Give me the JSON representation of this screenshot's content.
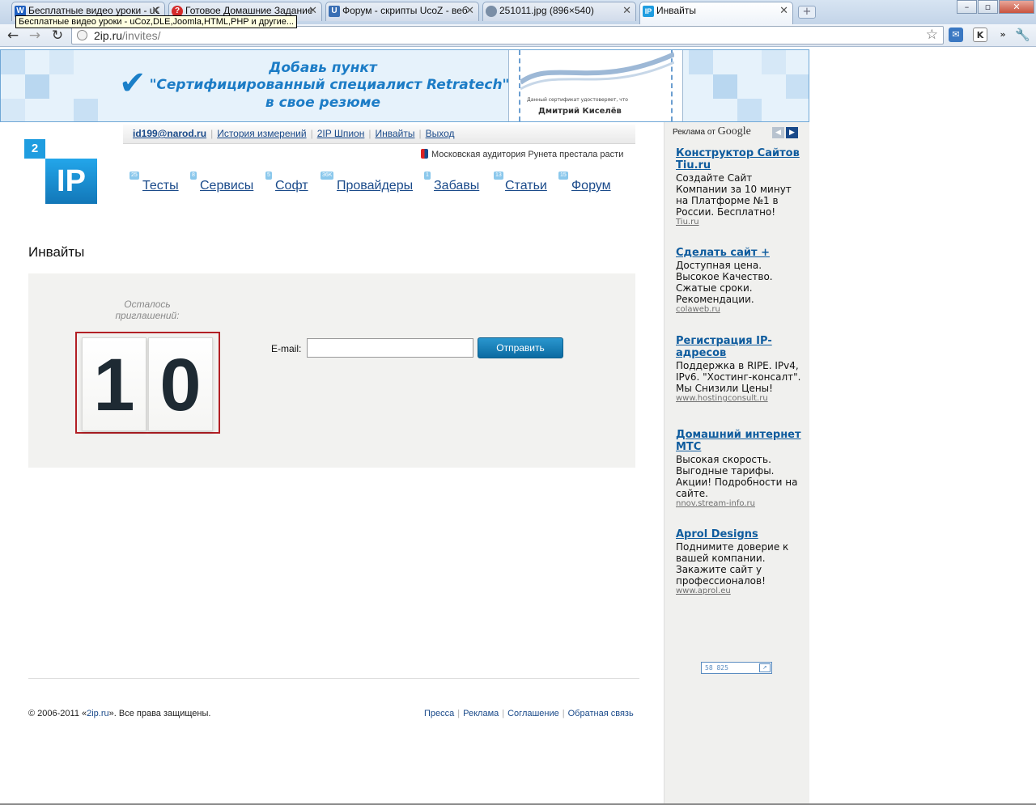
{
  "browser": {
    "tabs": [
      {
        "title": "Бесплатные видео уроки - uCoz",
        "favicon": "W",
        "favicon_color": "#1f5fbf",
        "active": false
      },
      {
        "title": "Готовое Домашние Задание",
        "favicon": "?",
        "favicon_color": "#d42a2a",
        "active": false
      },
      {
        "title": "Форум - скрипты UcoZ - веб",
        "favicon": "U",
        "favicon_color": "#3a6fb4",
        "active": false
      },
      {
        "title": "251011.jpg (896×540)",
        "favicon": "globe",
        "favicon_color": "#7a8ea6",
        "active": false
      },
      {
        "title": "Инвайты",
        "favicon": "IP",
        "favicon_color": "#1f9de0",
        "active": true
      }
    ],
    "tooltip": "Бесплатные видео уроки - uCoz,DLE,Joomla,HTML,PHP и другие...",
    "url_host": "2ip.ru",
    "url_path": "/invites/",
    "icons": {
      "back": "back-arrow-icon",
      "forward": "forward-arrow-icon",
      "reload": "reload-icon",
      "star": "bookmark-star-icon",
      "mail": "mail-icon",
      "ext": "k-extension-icon",
      "wrench": "wrench-icon"
    },
    "ext_label": "K"
  },
  "banner": {
    "line1": "Добавь пункт",
    "line2": "\"Сертифицированный специалист Retratech\"",
    "line3": "в свое резюме",
    "cert_text": "Данный сертификат удостоверяет, что",
    "cert_name": "Дмитрий Киселёв"
  },
  "topnav": {
    "email": "id199@narod.ru",
    "items": [
      "История измерений",
      "2IP Шпион",
      "Инвайты",
      "Выход"
    ]
  },
  "news": "Московская аудитория Рунета престала расти",
  "logo": {
    "small": "2",
    "big": "IP"
  },
  "menu": [
    {
      "badge": "25",
      "label": "Тесты"
    },
    {
      "badge": "8",
      "label": "Сервисы"
    },
    {
      "badge": "5",
      "label": "Софт"
    },
    {
      "badge": "36K",
      "label": "Провайдеры"
    },
    {
      "badge": "1",
      "label": "Забавы"
    },
    {
      "badge": "13",
      "label": "Статьи"
    },
    {
      "badge": "15",
      "label": "Форум"
    }
  ],
  "page": {
    "title": "Инвайты",
    "remaining_label": "Осталось приглашений:",
    "remaining_digits": [
      "1",
      "0"
    ],
    "email_label": "E-mail:",
    "email_value": "",
    "email_placeholder": "",
    "submit_label": "Отправить"
  },
  "footer": {
    "copyright_prefix": "© 2006-2011 «",
    "copyright_link": "2ip.ru",
    "copyright_suffix": "». Все права защищены.",
    "links": [
      "Пресса",
      "Реклама",
      "Соглашение",
      "Обратная связь"
    ]
  },
  "ads": {
    "header_prefix": "Реклама от",
    "header_brand": "Google",
    "items": [
      {
        "title": "Конструктор Сайтов Tiu.ru",
        "text": "Создайте Сайт Компании за 10 минут на Платформе №1 в России. Бесплатно!",
        "url": "Tiu.ru"
      },
      {
        "title": "Сделать сайт +",
        "text": "Доступная цена. Высокое Качество. Сжатые сроки. Рекомендации.",
        "url": "colaweb.ru"
      },
      {
        "title": "Регистрация IP-адресов",
        "text": "Поддержка в RIPE. IPv4, IPv6. \"Хостинг-консалт\". Мы Снизили Цены!",
        "url": "www.hostingconsult.ru"
      },
      {
        "title": "Домашний интернет МТС",
        "text": "Высокая скорость. Выгодные тарифы. Акции! Подробности на сайте.",
        "url": "nnov.stream-info.ru"
      },
      {
        "title": "Aprol Designs",
        "text": "Поднимите доверие к вашей компании. Закажите сайт у профессионалов!",
        "url": "www.aprol.eu"
      }
    ],
    "counter_value": "58 825"
  },
  "colors": {
    "link": "#1a4a8a",
    "brand_blue": "#1f9de0",
    "counter_border": "#b21f24",
    "button": "#0b6aa1"
  }
}
